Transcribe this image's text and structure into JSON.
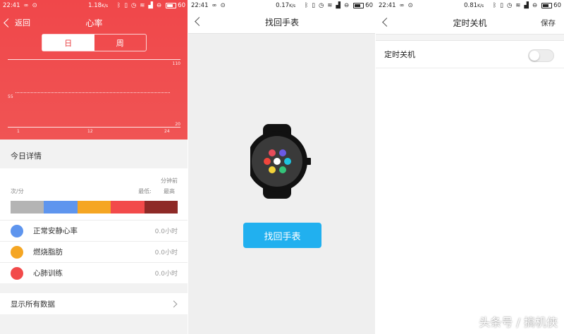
{
  "screen1": {
    "status": {
      "time": "22:41",
      "speed": "1.18",
      "speed_unit": "K/s",
      "battery": "60"
    },
    "back_label": "返回",
    "title": "心率",
    "tabs": [
      "日",
      "周"
    ],
    "chart_data": {
      "type": "line",
      "x_ticks": [
        "1",
        "12",
        "24"
      ],
      "y_ticks": [
        "110",
        "55",
        "20"
      ],
      "series": []
    },
    "section_title": "今日详情",
    "summary": {
      "unit": "次/分",
      "minutes_ago": "分钟前",
      "lowest": "最低:",
      "highest": "最高"
    },
    "zone_bar_colors": [
      "#b4b4b4",
      "#5e95ee",
      "#f5a623",
      "#f24a4a",
      "#8e2a27"
    ],
    "zones": [
      {
        "name": "正常安静心率",
        "value": "0.0小时",
        "color": "#5e95ee"
      },
      {
        "name": "燃烧脂肪",
        "value": "0.0小时",
        "color": "#f5a623"
      },
      {
        "name": "心肺训练",
        "value": "0.0小时",
        "color": "#f24a4a"
      }
    ],
    "show_all": "显示所有数据"
  },
  "screen2": {
    "status": {
      "time": "22:41",
      "speed": "0.17",
      "speed_unit": "K/s",
      "battery": "60"
    },
    "title": "找回手表",
    "button": "找回手表"
  },
  "screen3": {
    "status": {
      "time": "22:41",
      "speed": "0.81",
      "speed_unit": "K/s",
      "battery": "60"
    },
    "title": "定时关机",
    "save": "保存",
    "setting_label": "定时关机",
    "setting_on": false
  },
  "watermark": "头条号 / 搞机侠"
}
